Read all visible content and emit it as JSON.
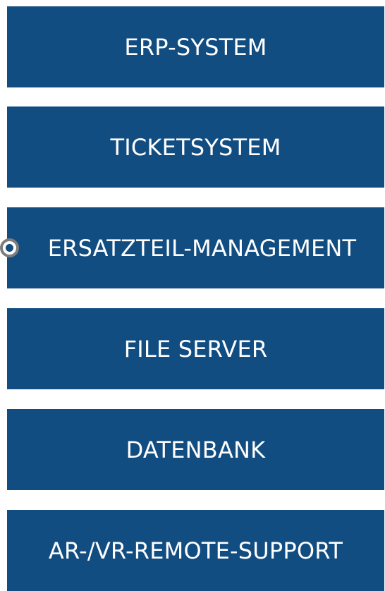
{
  "menu": {
    "items": [
      {
        "label": "ERP-SYSTEM"
      },
      {
        "label": "TICKETSYSTEM"
      },
      {
        "label": "ERSATZTEIL-MANAGEMENT",
        "selected": true
      },
      {
        "label": "FILE SERVER"
      },
      {
        "label": "DATENBANK"
      },
      {
        "label": "AR-/VR-REMOTE-SUPPORT"
      }
    ]
  },
  "colors": {
    "tile_background": "#124d82",
    "tile_text": "#ffffff",
    "page_background": "#ffffff",
    "radio_ring": "#7d7d7d"
  }
}
